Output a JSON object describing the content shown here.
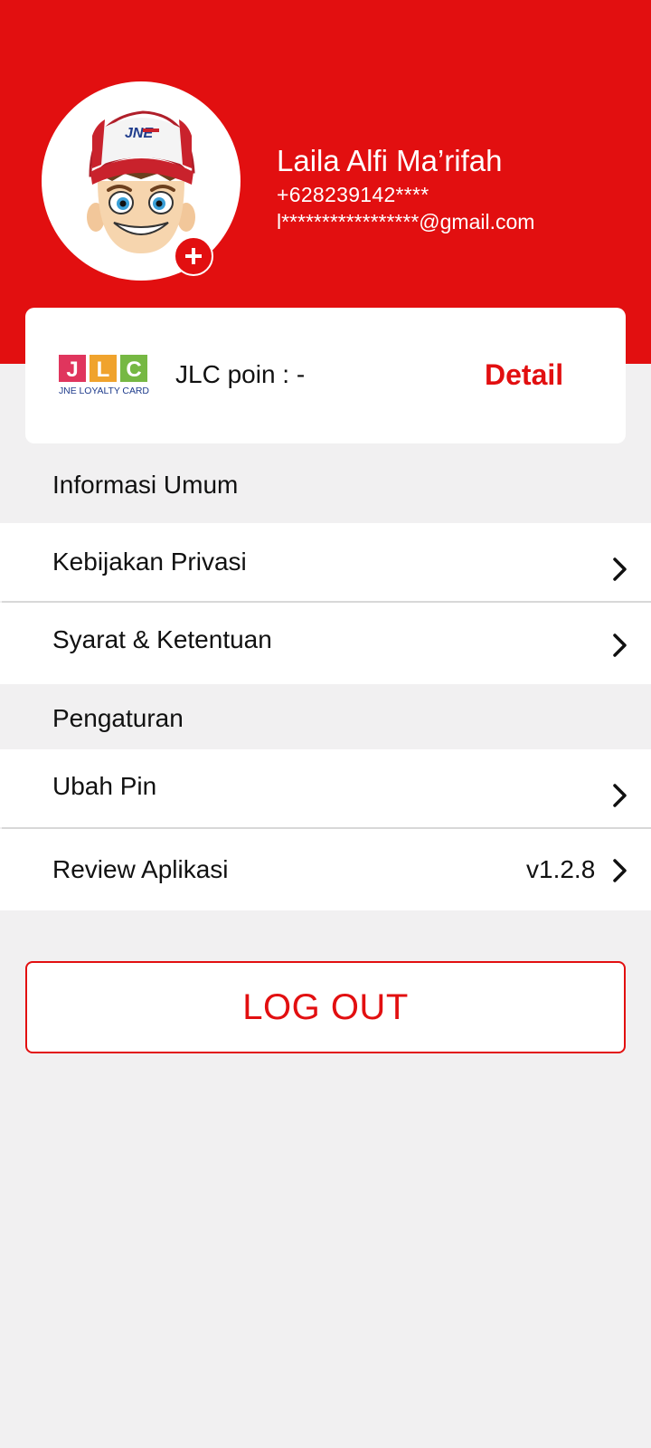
{
  "colors": {
    "brand_red": "#e20f10",
    "background": "#f1f0f1",
    "card": "#ffffff"
  },
  "profile": {
    "name": "Laila Alfi Ma’rifah",
    "phone": "+628239142****",
    "email": "l*****************@gmail.com",
    "avatar_icon": "jne-mascot-avatar",
    "add_photo_icon": "plus-icon"
  },
  "jlc": {
    "logo_letters": [
      "J",
      "L",
      "C"
    ],
    "logo_caption": "JNE LOYALTY CARD",
    "poin_text": "JLC poin : -",
    "detail_label": "Detail"
  },
  "sections": {
    "info_title": "Informasi Umum",
    "settings_title": "Pengaturan"
  },
  "menu": {
    "privacy": "Kebijakan Privasi",
    "terms": "Syarat & Ketentuan",
    "change_pin": "Ubah Pin",
    "review": "Review Aplikasi",
    "version": "v1.2.8"
  },
  "logout_label": "LOG OUT"
}
